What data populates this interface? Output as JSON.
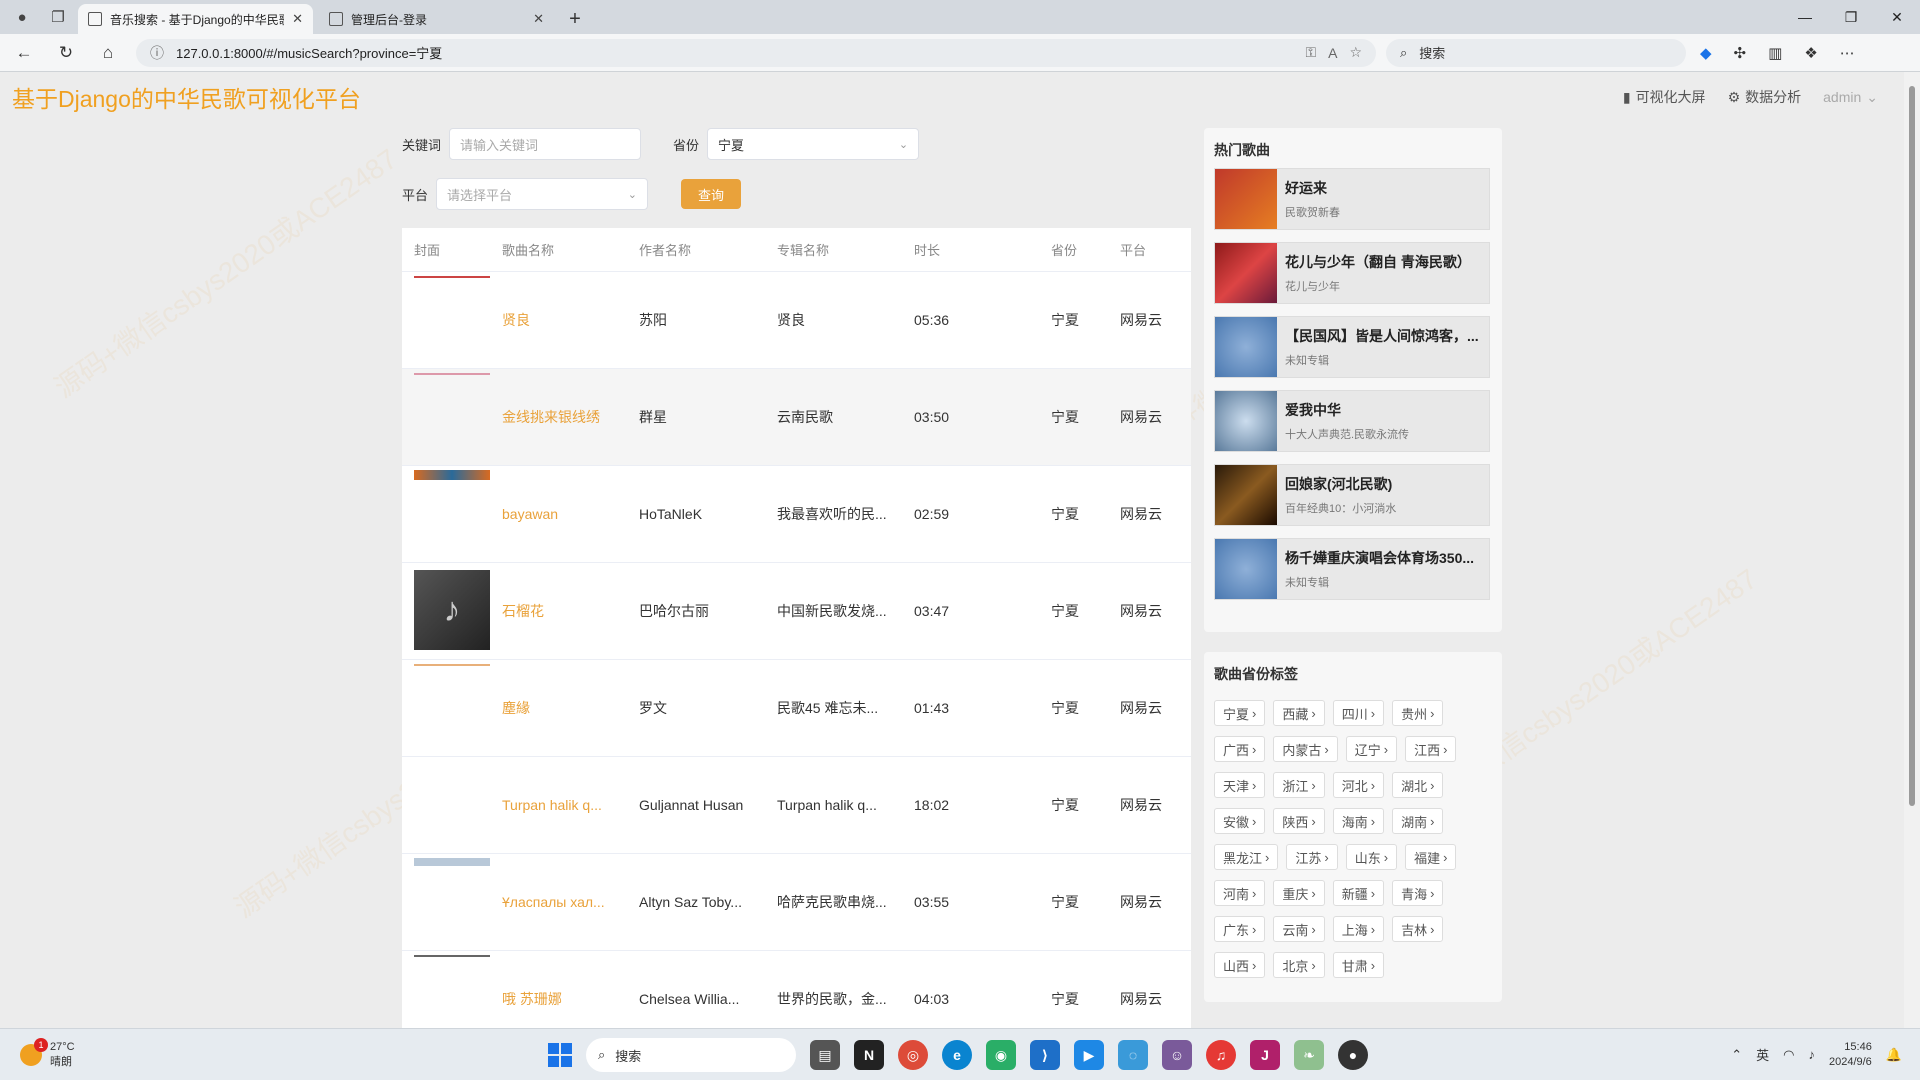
{
  "browser": {
    "tabs": [
      {
        "title": "音乐搜索 - 基于Django的中华民歌",
        "active": true
      },
      {
        "title": "管理后台-登录",
        "active": false
      }
    ],
    "url": "127.0.0.1:8000/#/musicSearch?province=宁夏",
    "search_placeholder": "搜索"
  },
  "header": {
    "brand": "基于Django的中华民歌可视化平台",
    "nav": [
      "可视化大屏",
      "数据分析"
    ],
    "user": "admin"
  },
  "filters": {
    "keyword_label": "关键词",
    "keyword_placeholder": "请输入关键词",
    "province_label": "省份",
    "province_value": "宁夏",
    "platform_label": "平台",
    "platform_placeholder": "请选择平台",
    "query_button": "查询"
  },
  "table": {
    "headers": [
      "封面",
      "歌曲名称",
      "作者名称",
      "专辑名称",
      "时长",
      "省份",
      "平台"
    ],
    "rows": [
      {
        "name": "贤良",
        "author": "苏阳",
        "album": "贤良",
        "duration": "05:36",
        "province": "宁夏",
        "platform": "网易云",
        "cover": "strip-red"
      },
      {
        "name": "金线挑来银线绣",
        "author": "群星",
        "album": "云南民歌",
        "duration": "03:50",
        "province": "宁夏",
        "platform": "网易云",
        "cover": "strip-pink"
      },
      {
        "name": "bayawan",
        "author": "HoTaNleK",
        "album": "我最喜欢听的民...",
        "duration": "02:59",
        "province": "宁夏",
        "platform": "网易云",
        "cover": "strip-blue"
      },
      {
        "name": "石榴花",
        "author": "巴哈尔古丽",
        "album": "中国新民歌发烧...",
        "duration": "03:47",
        "province": "宁夏",
        "platform": "网易云",
        "cover": "music-note"
      },
      {
        "name": "塵緣",
        "author": "罗文",
        "album": "民歌45 难忘未...",
        "duration": "01:43",
        "province": "宁夏",
        "platform": "网易云",
        "cover": "strip-orange"
      },
      {
        "name": "Turpan halik q...",
        "author": "Guljannat Husan",
        "album": "Turpan halik q...",
        "duration": "18:02",
        "province": "宁夏",
        "platform": "网易云",
        "cover": "none"
      },
      {
        "name": "Ұласпалы хал...",
        "author": "Altyn Saz Toby...",
        "album": "哈萨克民歌串烧...",
        "duration": "03:55",
        "province": "宁夏",
        "platform": "网易云",
        "cover": "strip-lightblue"
      },
      {
        "name": "哦 苏珊娜",
        "author": "Chelsea Willia...",
        "album": "世界的民歌，金...",
        "duration": "04:03",
        "province": "宁夏",
        "platform": "网易云",
        "cover": "strip-gray"
      }
    ]
  },
  "hot": {
    "title": "热门歌曲",
    "items": [
      {
        "name": "好运来",
        "sub": "民歌贺新春"
      },
      {
        "name": "花儿与少年（翻自 青海民歌）",
        "sub": "花儿与少年"
      },
      {
        "name": "【民国风】皆是人间惊鸿客，...",
        "sub": "未知专辑"
      },
      {
        "name": "爱我中华",
        "sub": "十大人声典范.民歌永流传"
      },
      {
        "name": "回娘家(河北民歌)",
        "sub": "百年经典10：小河淌水"
      },
      {
        "name": "杨千嬅重庆演唱会体育场350...",
        "sub": "未知专辑"
      }
    ]
  },
  "province_tags": {
    "title": "歌曲省份标签",
    "tags": [
      "宁夏",
      "西藏",
      "四川",
      "贵州",
      "广西",
      "内蒙古",
      "辽宁",
      "江西",
      "天津",
      "浙江",
      "河北",
      "湖北",
      "安徽",
      "陕西",
      "海南",
      "湖南",
      "黑龙江",
      "江苏",
      "山东",
      "福建",
      "河南",
      "重庆",
      "新疆",
      "青海",
      "广东",
      "云南",
      "上海",
      "吉林",
      "山西",
      "北京",
      "甘肃"
    ]
  },
  "taskbar": {
    "temp": "27°C",
    "weather": "晴朗",
    "notif_count": "1",
    "search": "搜索",
    "ime": "英",
    "time": "15:46",
    "date": "2024/9/6"
  },
  "watermark": "源码+微信csbys2020或ACE2487"
}
